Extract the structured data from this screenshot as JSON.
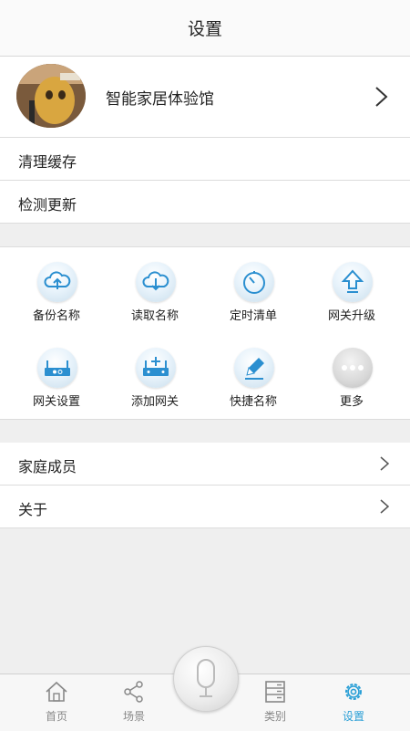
{
  "header": {
    "title": "设置"
  },
  "profile": {
    "name": "智能家居体验馆"
  },
  "menu_top": [
    {
      "label": "清理缓存"
    },
    {
      "label": "检测更新"
    }
  ],
  "grid": [
    {
      "label": "备份名称",
      "icon": "cloud-upload-icon"
    },
    {
      "label": "读取名称",
      "icon": "cloud-download-icon"
    },
    {
      "label": "定时清单",
      "icon": "timer-icon"
    },
    {
      "label": "网关升级",
      "icon": "upgrade-arrow-icon"
    },
    {
      "label": "网关设置",
      "icon": "gateway-settings-icon"
    },
    {
      "label": "添加网关",
      "icon": "add-gateway-icon"
    },
    {
      "label": "快捷名称",
      "icon": "pencil-icon"
    },
    {
      "label": "更多",
      "icon": "more-dots-icon"
    }
  ],
  "menu_bottom": [
    {
      "label": "家庭成员"
    },
    {
      "label": "关于"
    }
  ],
  "tabs": [
    {
      "label": "首页",
      "icon": "home-icon"
    },
    {
      "label": "场景",
      "icon": "share-icon"
    },
    {
      "label": "类别",
      "icon": "list-icon"
    },
    {
      "label": "设置",
      "icon": "gear-icon",
      "active": true
    }
  ],
  "colors": {
    "accent": "#2a9fd6",
    "icon_blue": "#2b8fd0",
    "background": "#efefef"
  }
}
